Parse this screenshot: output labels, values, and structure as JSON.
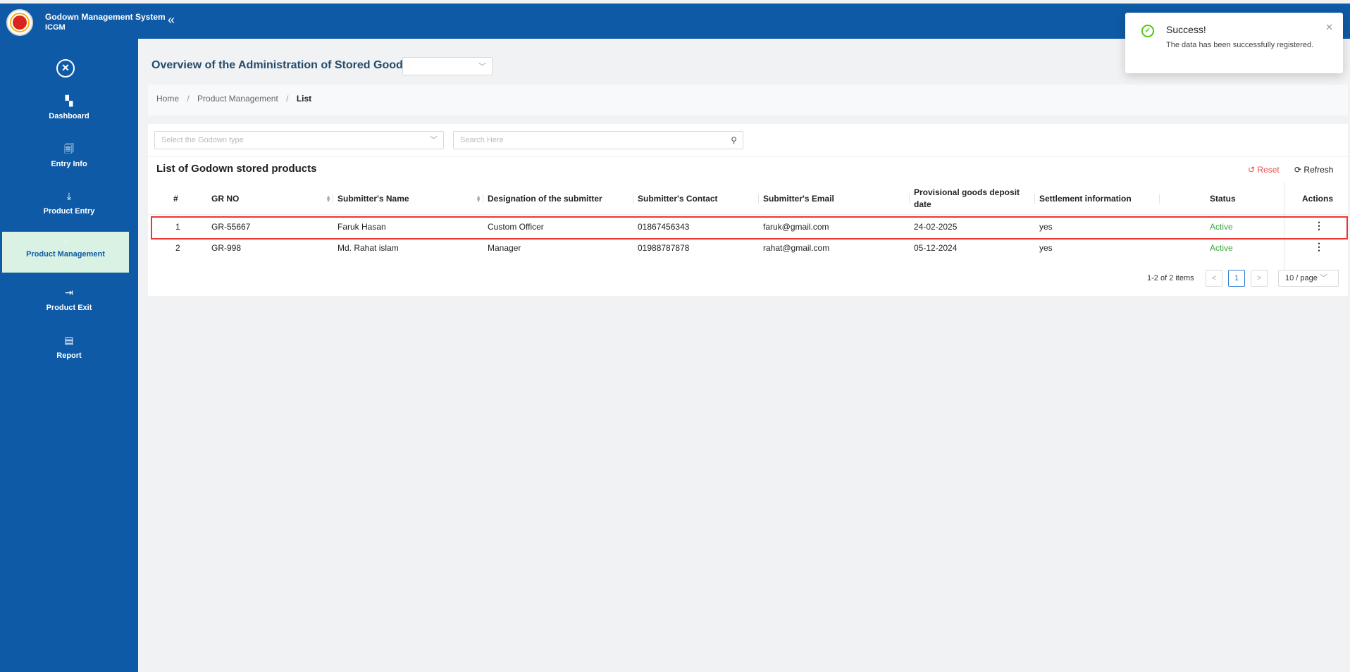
{
  "app": {
    "title": "Godown Management System",
    "subtitle": "ICGM",
    "collapse_icon": "«"
  },
  "sidebar": {
    "close_icon": "✕",
    "items": [
      {
        "label": "Dashboard",
        "icon": "▚"
      },
      {
        "label": "Entry Info",
        "icon": "🗐"
      },
      {
        "label": "Product Entry",
        "icon": "⤓"
      },
      {
        "label": "Product Management",
        "icon": "i"
      },
      {
        "label": "Product Exit",
        "icon": "⇥"
      },
      {
        "label": "Report",
        "icon": "▤"
      }
    ]
  },
  "page": {
    "title": "Overview of the Administration of Stored Goods"
  },
  "breadcrumb": {
    "items": [
      "Home",
      "Product Management",
      "List"
    ],
    "separator": "/"
  },
  "filters": {
    "godown_placeholder": "Select the Godown type",
    "search_placeholder": "Search Here"
  },
  "list": {
    "title": "List of Godown stored products",
    "reset_label": "Reset",
    "refresh_label": "Refresh",
    "columns": [
      "#",
      "GR NO",
      "Submitter's Name",
      "Designation of the submitter",
      "Submitter's Contact",
      "Submitter's Email",
      "Provisional goods deposit date",
      "Settlement information",
      "Status",
      "Actions"
    ],
    "rows": [
      {
        "num": "1",
        "gr_no": "GR-55667",
        "name": "Faruk Hasan",
        "designation": "Custom Officer",
        "contact": "01867456343",
        "email": "faruk@gmail.com",
        "date": "24-02-2025",
        "settlement": "yes",
        "status": "Active",
        "action": "⋮"
      },
      {
        "num": "2",
        "gr_no": "GR-998",
        "name": "Md. Rahat islam",
        "designation": "Manager",
        "contact": "01988787878",
        "email": "rahat@gmail.com",
        "date": "05-12-2024",
        "settlement": "yes",
        "status": "Active",
        "action": "⋮"
      }
    ]
  },
  "pagination": {
    "total_text": "1-2 of 2 items",
    "prev": "<",
    "current_page": "1",
    "next": ">",
    "page_size": "10 / page"
  },
  "toast": {
    "title": "Success!",
    "message": "The data has been successfully registered.",
    "close": "✕",
    "icon": "✓"
  },
  "colors": {
    "primary": "#0f5aa6",
    "active_nav_bg": "#d9f2e4",
    "status_active": "#3aa63a",
    "reset": "#f0504a",
    "success": "#52c41a",
    "highlight": "#ee3333"
  }
}
